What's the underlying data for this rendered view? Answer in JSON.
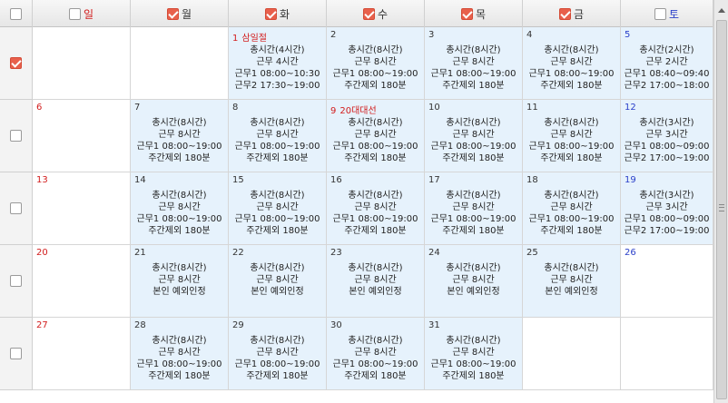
{
  "header": {
    "select_all_checked": false,
    "days": [
      {
        "label": "일",
        "checked": false,
        "tone": "sun"
      },
      {
        "label": "월",
        "checked": true,
        "tone": "normal"
      },
      {
        "label": "화",
        "checked": true,
        "tone": "normal"
      },
      {
        "label": "수",
        "checked": true,
        "tone": "normal"
      },
      {
        "label": "목",
        "checked": true,
        "tone": "normal"
      },
      {
        "label": "금",
        "checked": true,
        "tone": "normal"
      },
      {
        "label": "토",
        "checked": false,
        "tone": "sat"
      }
    ]
  },
  "colors": {
    "accent": "#e8604c",
    "sunday": "#d21c1c",
    "saturday": "#2a3fc9",
    "work_bg": "#e6f2fc"
  },
  "weeks": [
    {
      "selected": true,
      "days": [
        {
          "num": "",
          "holiday": "",
          "lines": []
        },
        {
          "num": "",
          "holiday": "",
          "lines": []
        },
        {
          "num": "1",
          "holiday": "삼일절",
          "lines": [
            "총시간(4시간)",
            "근무 4시간",
            "근무1 08:00~10:30",
            "근무2 17:30~19:00"
          ]
        },
        {
          "num": "2",
          "holiday": "",
          "lines": [
            "총시간(8시간)",
            "근무 8시간",
            "근무1 08:00~19:00",
            "주간제외 180분"
          ]
        },
        {
          "num": "3",
          "holiday": "",
          "lines": [
            "총시간(8시간)",
            "근무 8시간",
            "근무1 08:00~19:00",
            "주간제외 180분"
          ]
        },
        {
          "num": "4",
          "holiday": "",
          "lines": [
            "총시간(8시간)",
            "근무 8시간",
            "근무1 08:00~19:00",
            "주간제외 180분"
          ]
        },
        {
          "num": "5",
          "holiday": "",
          "lines": [
            "총시간(2시간)",
            "근무 2시간",
            "근무1 08:40~09:40",
            "근무2 17:00~18:00"
          ]
        }
      ]
    },
    {
      "selected": false,
      "days": [
        {
          "num": "6",
          "holiday": "",
          "lines": []
        },
        {
          "num": "7",
          "holiday": "",
          "lines": [
            "총시간(8시간)",
            "근무 8시간",
            "근무1 08:00~19:00",
            "주간제외 180분"
          ]
        },
        {
          "num": "8",
          "holiday": "",
          "lines": [
            "총시간(8시간)",
            "근무 8시간",
            "근무1 08:00~19:00",
            "주간제외 180분"
          ]
        },
        {
          "num": "9",
          "holiday": "20대대선",
          "lines": [
            "총시간(8시간)",
            "근무 8시간",
            "근무1 08:00~19:00",
            "주간제외 180분"
          ]
        },
        {
          "num": "10",
          "holiday": "",
          "lines": [
            "총시간(8시간)",
            "근무 8시간",
            "근무1 08:00~19:00",
            "주간제외 180분"
          ]
        },
        {
          "num": "11",
          "holiday": "",
          "lines": [
            "총시간(8시간)",
            "근무 8시간",
            "근무1 08:00~19:00",
            "주간제외 180분"
          ]
        },
        {
          "num": "12",
          "holiday": "",
          "lines": [
            "총시간(3시간)",
            "근무 3시간",
            "근무1 08:00~09:00",
            "근무2 17:00~19:00"
          ]
        }
      ]
    },
    {
      "selected": false,
      "days": [
        {
          "num": "13",
          "holiday": "",
          "lines": []
        },
        {
          "num": "14",
          "holiday": "",
          "lines": [
            "총시간(8시간)",
            "근무 8시간",
            "근무1 08:00~19:00",
            "주간제외 180분"
          ]
        },
        {
          "num": "15",
          "holiday": "",
          "lines": [
            "총시간(8시간)",
            "근무 8시간",
            "근무1 08:00~19:00",
            "주간제외 180분"
          ]
        },
        {
          "num": "16",
          "holiday": "",
          "lines": [
            "총시간(8시간)",
            "근무 8시간",
            "근무1 08:00~19:00",
            "주간제외 180분"
          ]
        },
        {
          "num": "17",
          "holiday": "",
          "lines": [
            "총시간(8시간)",
            "근무 8시간",
            "근무1 08:00~19:00",
            "주간제외 180분"
          ]
        },
        {
          "num": "18",
          "holiday": "",
          "lines": [
            "총시간(8시간)",
            "근무 8시간",
            "근무1 08:00~19:00",
            "주간제외 180분"
          ]
        },
        {
          "num": "19",
          "holiday": "",
          "lines": [
            "총시간(3시간)",
            "근무 3시간",
            "근무1 08:00~09:00",
            "근무2 17:00~19:00"
          ]
        }
      ]
    },
    {
      "selected": false,
      "days": [
        {
          "num": "20",
          "holiday": "",
          "lines": []
        },
        {
          "num": "21",
          "holiday": "",
          "lines": [
            "총시간(8시간)",
            "근무 8시간",
            "본인 예외인정"
          ]
        },
        {
          "num": "22",
          "holiday": "",
          "lines": [
            "총시간(8시간)",
            "근무 8시간",
            "본인 예외인정"
          ]
        },
        {
          "num": "23",
          "holiday": "",
          "lines": [
            "총시간(8시간)",
            "근무 8시간",
            "본인 예외인정"
          ]
        },
        {
          "num": "24",
          "holiday": "",
          "lines": [
            "총시간(8시간)",
            "근무 8시간",
            "본인 예외인정"
          ]
        },
        {
          "num": "25",
          "holiday": "",
          "lines": [
            "총시간(8시간)",
            "근무 8시간",
            "본인 예외인정"
          ]
        },
        {
          "num": "26",
          "holiday": "",
          "lines": []
        }
      ]
    },
    {
      "selected": false,
      "days": [
        {
          "num": "27",
          "holiday": "",
          "lines": []
        },
        {
          "num": "28",
          "holiday": "",
          "lines": [
            "총시간(8시간)",
            "근무 8시간",
            "근무1 08:00~19:00",
            "주간제외 180분"
          ]
        },
        {
          "num": "29",
          "holiday": "",
          "lines": [
            "총시간(8시간)",
            "근무 8시간",
            "근무1 08:00~19:00",
            "주간제외 180분"
          ]
        },
        {
          "num": "30",
          "holiday": "",
          "lines": [
            "총시간(8시간)",
            "근무 8시간",
            "근무1 08:00~19:00",
            "주간제외 180분"
          ]
        },
        {
          "num": "31",
          "holiday": "",
          "lines": [
            "총시간(8시간)",
            "근무 8시간",
            "근무1 08:00~19:00",
            "주간제외 180분"
          ]
        },
        {
          "num": "",
          "holiday": "",
          "lines": []
        },
        {
          "num": "",
          "holiday": "",
          "lines": []
        }
      ]
    }
  ]
}
